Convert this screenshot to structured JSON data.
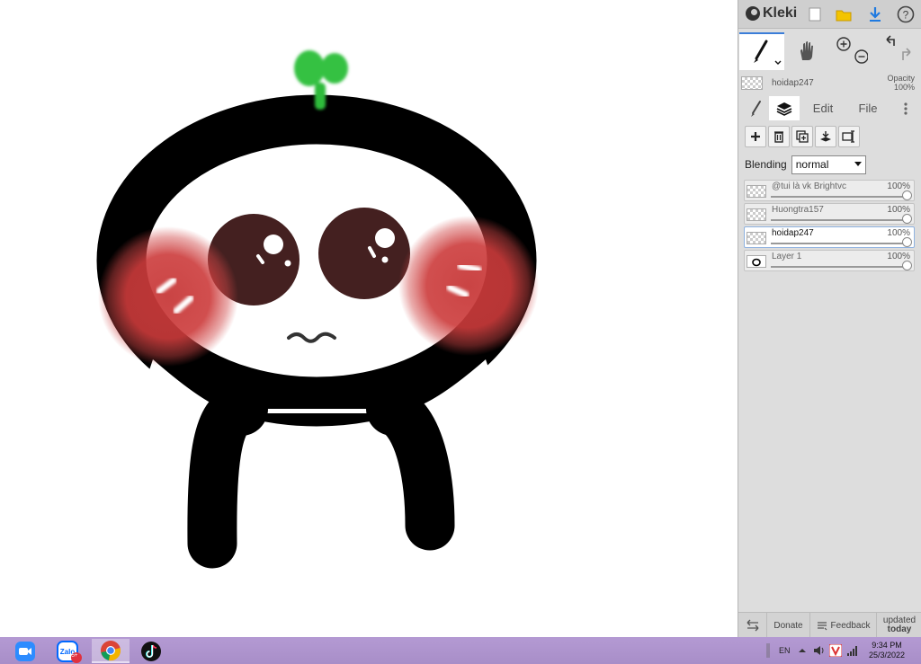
{
  "app": {
    "name": "Kleki"
  },
  "topbar_icons": [
    "new-image-icon",
    "open-folder-icon",
    "download-icon",
    "help-icon"
  ],
  "current_layer": {
    "name": "hoidap247",
    "opacity_label": "Opacity",
    "opacity_value": "100%"
  },
  "tabs": {
    "edit": "Edit",
    "file": "File"
  },
  "blending": {
    "label": "Blending",
    "value": "normal"
  },
  "layers": [
    {
      "name": "@tui là vk Brightvc",
      "opacity": "100%"
    },
    {
      "name": "Huongtra157",
      "opacity": "100%"
    },
    {
      "name": "hoidap247",
      "opacity": "100%"
    },
    {
      "name": "Layer 1",
      "opacity": "100%"
    }
  ],
  "bottombar": {
    "donate": "Donate",
    "feedback": "Feedback",
    "updated_line1": "updated",
    "updated_line2": "today"
  },
  "taskbar": {
    "apps": [
      "zoom-icon",
      "zalo-icon",
      "chrome-icon",
      "tiktok-icon"
    ],
    "zalo_badge": "5+",
    "language": "EN",
    "time": "9:34 PM",
    "date": "25/3/2022"
  },
  "colors": {
    "accent": "#3b7dd8",
    "taskbar": "#ac92cc",
    "panel": "#dddddd"
  }
}
